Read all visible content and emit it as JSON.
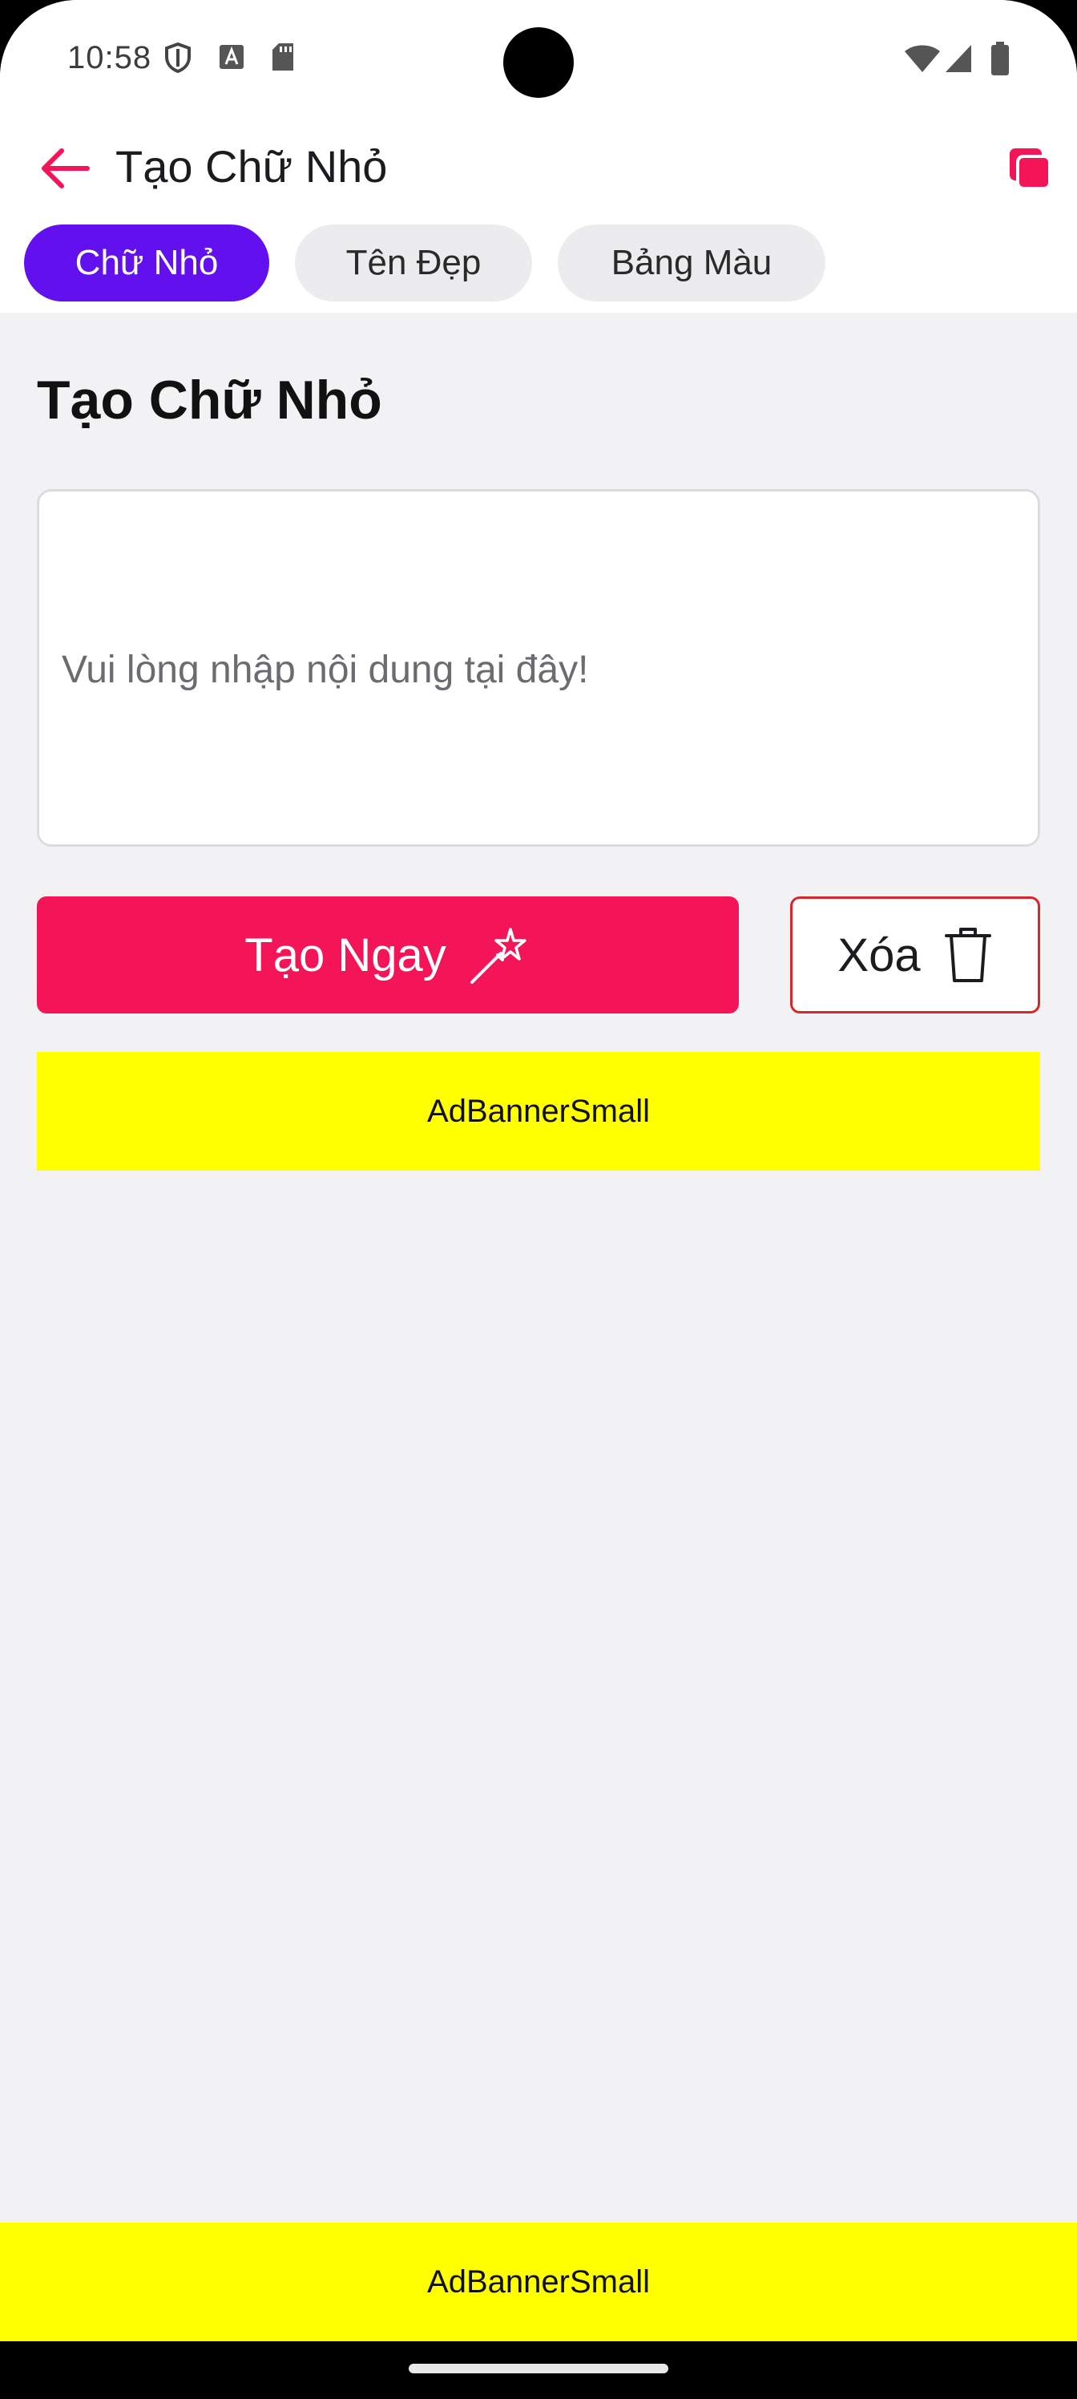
{
  "status_bar": {
    "time": "10:58",
    "left_icons": [
      "shield-icon",
      "text-a-icon",
      "sd-card-icon"
    ],
    "right_icons": [
      "wifi-icon",
      "signal-icon",
      "battery-icon"
    ]
  },
  "app_bar": {
    "title": "Tạo Chữ Nhỏ",
    "back_icon": "arrow-left-icon",
    "copy_icon": "copy-icon",
    "accent_color": "#f41458"
  },
  "tabs": [
    {
      "label": "Chữ Nhỏ",
      "active": true
    },
    {
      "label": "Tên Đẹp",
      "active": false
    },
    {
      "label": "Bảng Màu",
      "active": false
    }
  ],
  "main": {
    "section_title": "Tạo Chữ Nhỏ",
    "input": {
      "value": "",
      "placeholder": "Vui lòng nhập nội dung tại đây!"
    },
    "create_button": {
      "label": "Tạo Ngay",
      "icon": "magic-wand-icon",
      "color": "#f41458"
    },
    "clear_button": {
      "label": "Xóa",
      "icon": "trash-icon",
      "border_color": "#d62828"
    },
    "ad_banner": "AdBannerSmall"
  },
  "bottom_ad": "AdBannerSmall",
  "colors": {
    "tab_active": "#6211ee",
    "ad_background": "#ffff00",
    "page_background": "#f2f1f4"
  }
}
